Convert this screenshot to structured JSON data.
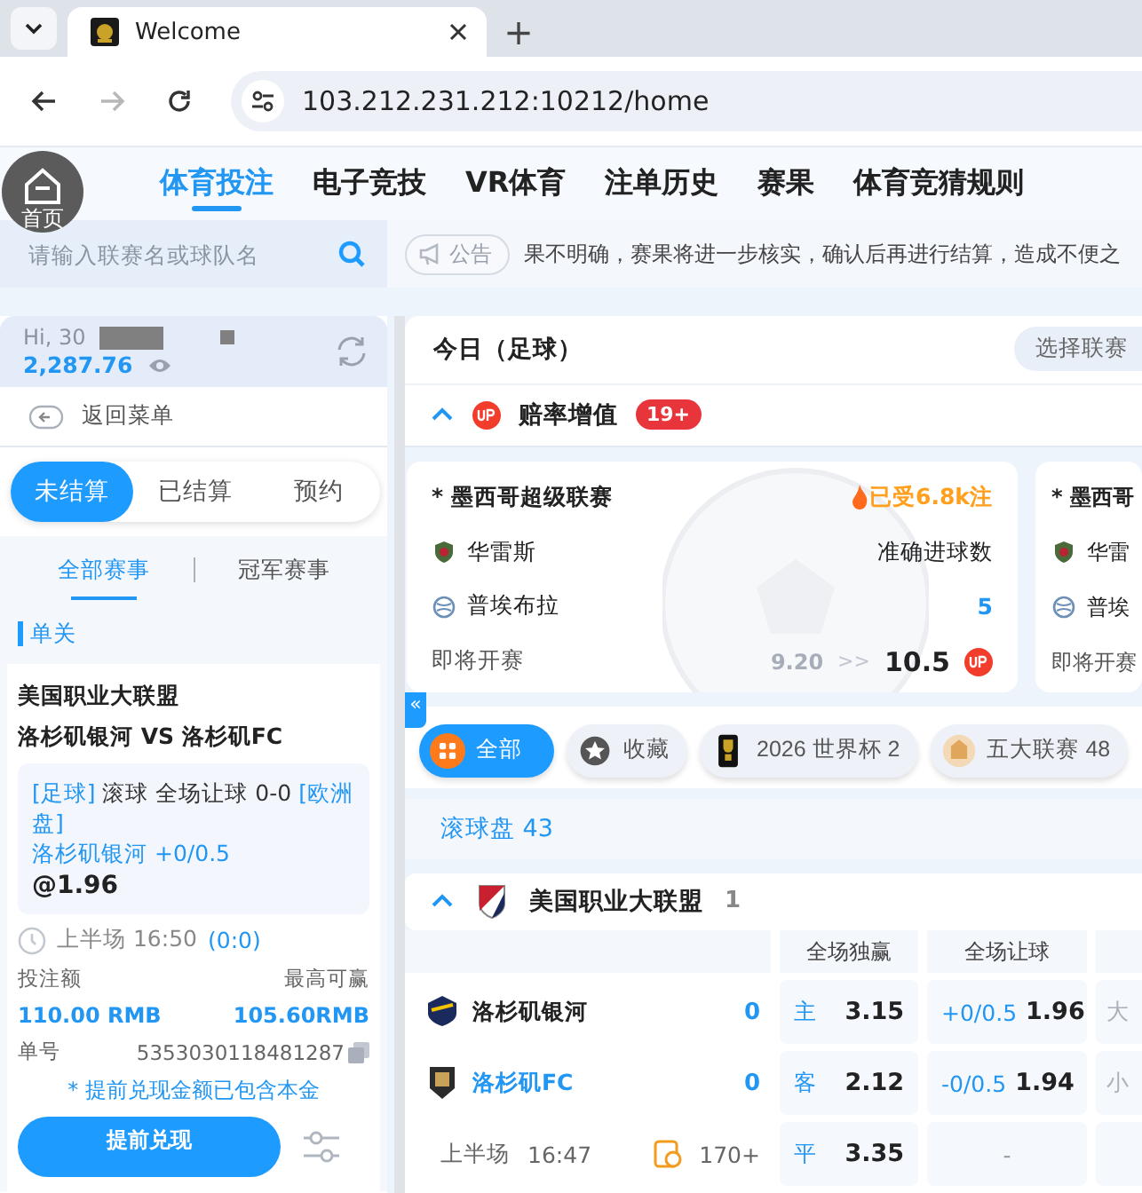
{
  "browser": {
    "tabs": [
      {
        "title": "Welcome",
        "selected": true
      }
    ],
    "new_tab": "+",
    "address": "103.212.231.212:10212/home",
    "nav_buttons": [
      {
        "kind": "back",
        "disabled": false
      },
      {
        "kind": "forward",
        "disabled": true
      },
      {
        "kind": "reload",
        "disabled": false
      }
    ]
  },
  "app_nav": {
    "home_label": "首页",
    "items": [
      {
        "label": "体育投注",
        "selected": true
      },
      {
        "label": "电子竞技",
        "selected": false
      },
      {
        "label": "VR体育",
        "selected": false
      },
      {
        "label": "注单历史",
        "selected": false
      },
      {
        "label": "赛果",
        "selected": false
      },
      {
        "label": "体育竞猜规则",
        "selected": false
      }
    ]
  },
  "search": {
    "placeholder": "请输入联赛名或球队名"
  },
  "notice": {
    "label": "公告",
    "text": "果不明确，赛果将进一步核实，确认后再进行结算，造成不便之"
  },
  "account": {
    "greeting": "Hi, 30",
    "balance": "2,287.76"
  },
  "back_menu": "返回菜单",
  "bet_tabs": [
    {
      "label": "未结算",
      "selected": true
    },
    {
      "label": "已结算",
      "selected": false
    },
    {
      "label": "预约",
      "selected": false
    }
  ],
  "bet_filters": [
    {
      "label": "全部赛事",
      "selected": true
    },
    {
      "label": "冠军赛事",
      "selected": false
    }
  ],
  "section": "单关",
  "bet": {
    "league": "美国职业大联盟",
    "match": "洛杉矶银河 VS 洛杉矶FC",
    "detail": [
      {
        "kind": "tag",
        "text": "[足球]"
      },
      {
        "kind": "plain",
        "text": " 滚球 全场让球 0-0 "
      },
      {
        "kind": "tag",
        "text": "[欧洲盘]"
      }
    ],
    "selection": "洛杉矶银河 +0/0.5",
    "odds": "@1.96",
    "period": "上半场 16:50",
    "score": "(0:0)",
    "stake_label": "投注额",
    "max_win_label": "最高可赢",
    "stake": "110.00 RMB",
    "max_win": "105.60RMB",
    "order_label": "单号",
    "order_no": "5353030118481287",
    "note": "* 提前兑现金额已包含本金",
    "cashout_button": "提前兑现"
  },
  "collapse": "«",
  "main": {
    "title": "今日（足球）",
    "league_select": "选择联赛",
    "boost": {
      "expanded": true,
      "label": "赔率增值",
      "badge": "19+"
    },
    "boost_cards": [
      {
        "league": "* 墨西哥超级联赛",
        "popularity": "已受6.8k注",
        "home": "华雷斯",
        "away": "普埃布拉",
        "market": "准确进球数",
        "selection": "5",
        "status": "即将开赛",
        "old_odds": "9.20",
        "arrow": ">>",
        "new_odds": "10.5"
      },
      {
        "league": "* 墨西哥",
        "home": "华雷",
        "away": "普埃",
        "status": "即将开赛"
      }
    ],
    "chips": [
      {
        "kind": "all",
        "label": "全部",
        "selected": true
      },
      {
        "kind": "favorite",
        "label": "收藏",
        "selected": false
      },
      {
        "kind": "trophy",
        "label": "2026 世界杯 2",
        "selected": false
      },
      {
        "kind": "emblem",
        "label": "五大联赛 48",
        "selected": false
      }
    ],
    "live_count": "滚球盘 43",
    "league": {
      "expanded": true,
      "name": "美国职业大联盟",
      "count": "1",
      "columns": [
        "全场独赢",
        "全场让球"
      ],
      "teams": [
        {
          "name": "洛杉矶银河",
          "highlight": false,
          "score": "0",
          "side": "主",
          "win_odds": "3.15",
          "handicap": "+0/0.5",
          "handicap_odds": "1.96",
          "column_3": "大"
        },
        {
          "name": "洛杉矶FC",
          "highlight": true,
          "score": "0",
          "side": "客",
          "win_odds": "2.12",
          "handicap": "-0/0.5",
          "handicap_odds": "1.94",
          "column_3": "小"
        }
      ],
      "draw": {
        "side": "平",
        "odds": "3.35",
        "handicap": "-"
      },
      "period": "上半场",
      "time": "16:47",
      "bets": "170+"
    }
  }
}
